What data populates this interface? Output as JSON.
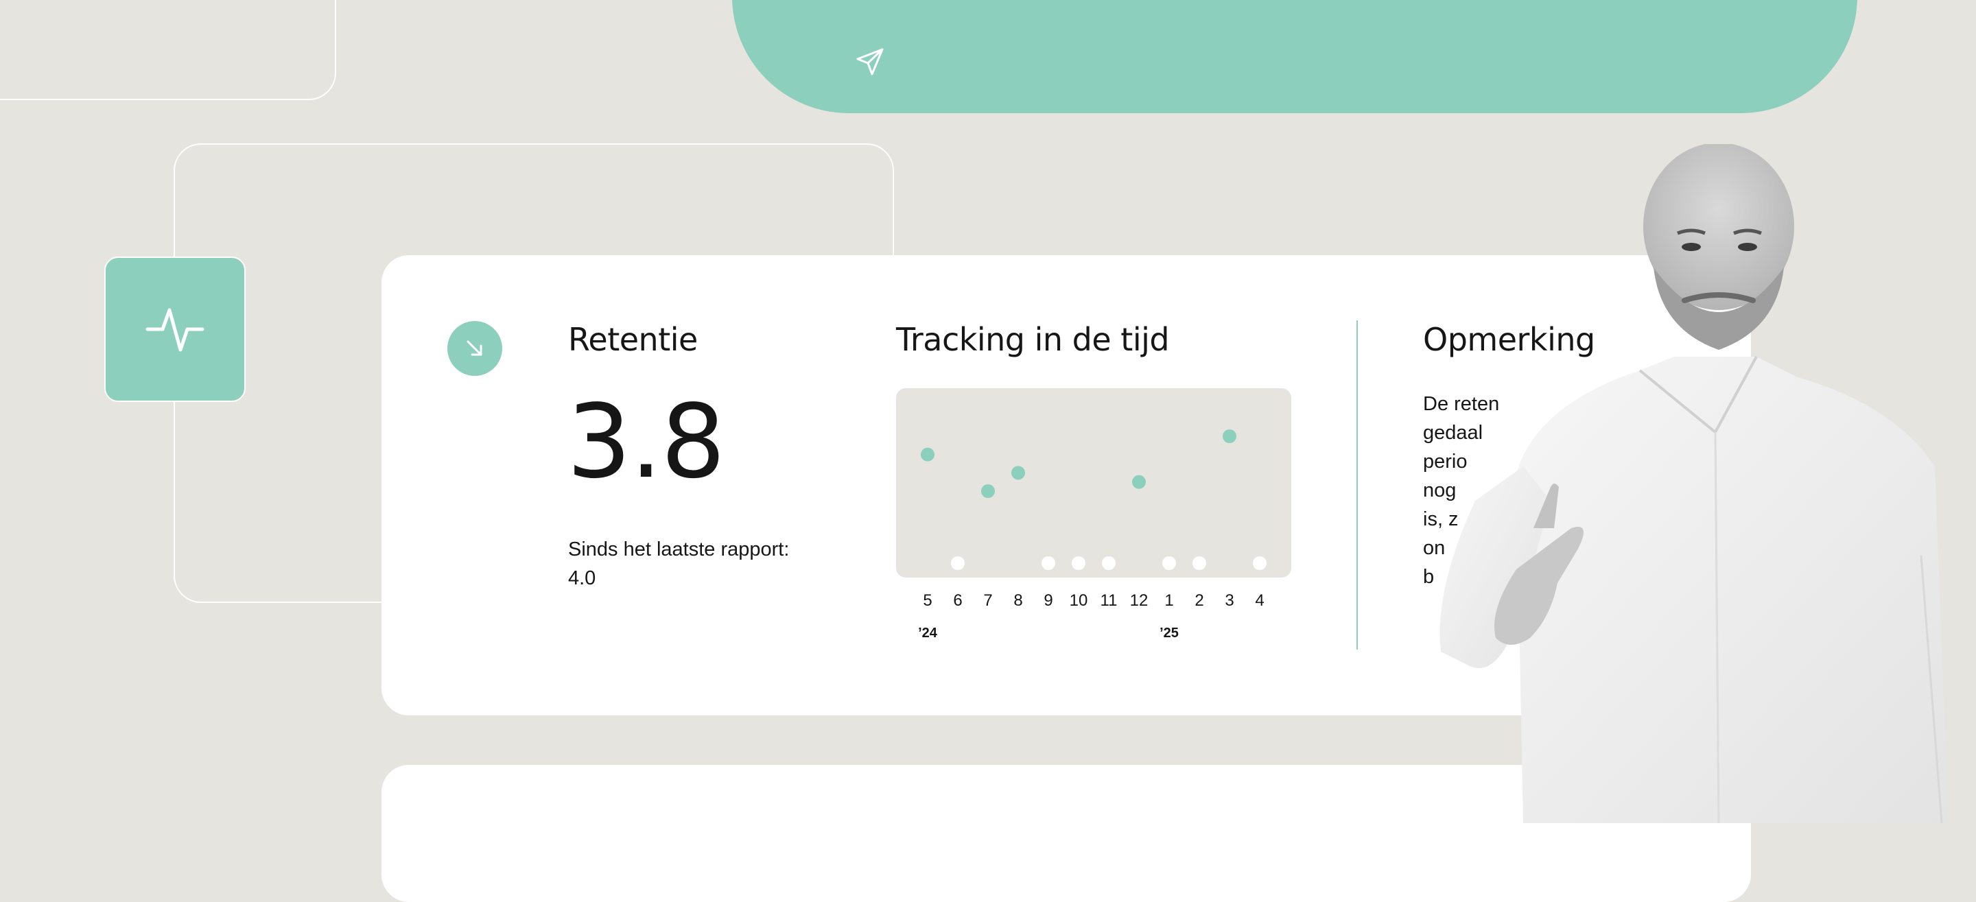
{
  "icons": {
    "send": "send-icon",
    "pulse": "pulse-icon",
    "trend": "arrow-down-right-icon"
  },
  "colors": {
    "background": "#e5e4df",
    "accent": "#8ccfbc",
    "card": "#ffffff",
    "text": "#161616"
  },
  "metric": {
    "title": "Retentie",
    "value": "3.8",
    "since_label": "Sinds het laatste rapport:",
    "previous_value": "4.0"
  },
  "tracking": {
    "title": "Tracking in de tijd"
  },
  "chart_data": {
    "type": "scatter",
    "title": "Tracking in de tijd",
    "x_tick_labels": [
      "5",
      "6",
      "7",
      "8",
      "9",
      "10",
      "11",
      "12",
      "1",
      "2",
      "3",
      "4"
    ],
    "year_labels": [
      {
        "at_tick": "5",
        "label": "’24"
      },
      {
        "at_tick": "1",
        "label": "’25"
      }
    ],
    "points": [
      {
        "x": "5",
        "y": 3.9,
        "has_value": true
      },
      {
        "x": "6",
        "y": null,
        "has_value": false
      },
      {
        "x": "7",
        "y": 3.7,
        "has_value": true
      },
      {
        "x": "8",
        "y": 3.8,
        "has_value": true
      },
      {
        "x": "9",
        "y": null,
        "has_value": false
      },
      {
        "x": "10",
        "y": null,
        "has_value": false
      },
      {
        "x": "11",
        "y": null,
        "has_value": false
      },
      {
        "x": "12",
        "y": 3.75,
        "has_value": true
      },
      {
        "x": "1",
        "y": null,
        "has_value": false
      },
      {
        "x": "2",
        "y": null,
        "has_value": false
      },
      {
        "x": "3",
        "y": 4.0,
        "has_value": true
      },
      {
        "x": "4",
        "y": null,
        "has_value": false
      }
    ],
    "ylim": [
      3.0,
      4.5
    ],
    "grid": false,
    "legend": "none",
    "value_color": "#8ccfbc",
    "empty_color": "#ffffff"
  },
  "remark": {
    "title": "Opmerking",
    "lines": [
      "De reten",
      "gedaal",
      "perio",
      "nog",
      "is, z",
      "on",
      "b"
    ]
  }
}
